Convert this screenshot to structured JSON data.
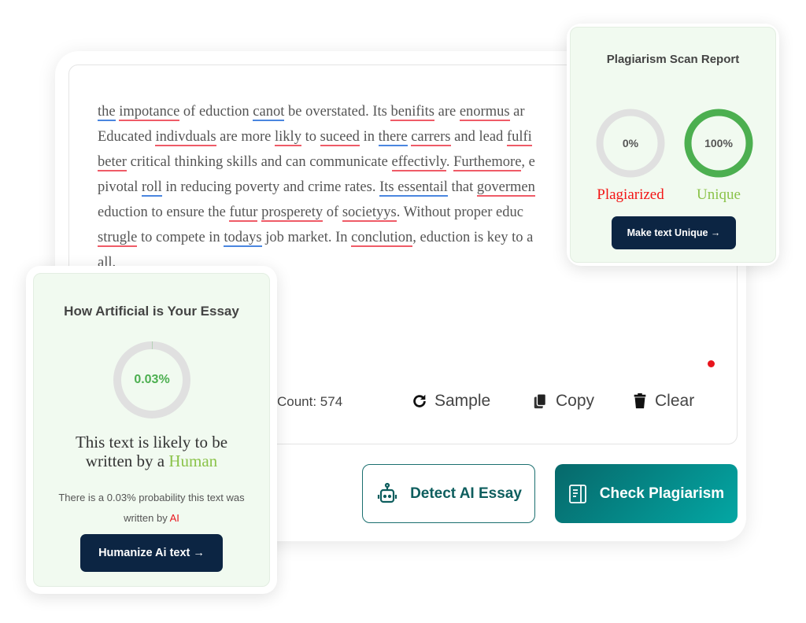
{
  "essay": {
    "lines": [
      [
        [
          "the",
          "b"
        ],
        " ",
        [
          "impotance",
          "r"
        ],
        " of eduction ",
        [
          "canot",
          "b"
        ],
        " be overstated. Its ",
        [
          "benifits",
          "r"
        ],
        " are ",
        [
          "enormus",
          "r"
        ],
        " ar"
      ],
      [
        "Educated ",
        [
          "indivduals",
          "r"
        ],
        " are more ",
        [
          "likly",
          "r"
        ],
        " to ",
        [
          "suceed",
          "r"
        ],
        " in ",
        [
          "there",
          "b"
        ],
        " ",
        [
          "carrers",
          "r"
        ],
        " and lead ",
        [
          "fulfi",
          "r"
        ]
      ],
      [
        [
          "beter",
          "r"
        ],
        " critical thinking skills and can communicate ",
        [
          "effectivly",
          "r"
        ],
        ". ",
        [
          "Furthemore",
          "r"
        ],
        ", e"
      ],
      [
        "pivotal ",
        [
          "roll",
          "b"
        ],
        " in reducing poverty and crime rates. ",
        [
          "Its essentail",
          "b"
        ],
        " that ",
        [
          "govermen",
          "r"
        ]
      ],
      [
        "eduction to ensure the ",
        [
          "futur",
          "r"
        ],
        " ",
        [
          "prosperety",
          "r"
        ],
        " of ",
        [
          "societyys",
          "r"
        ],
        ". Without proper educ"
      ],
      [
        [
          "strugle",
          "r"
        ],
        " to compete in ",
        [
          "todays",
          "b"
        ],
        " job market. In ",
        [
          "conclution",
          "r"
        ],
        ", eduction is key to a"
      ],
      [
        "all."
      ]
    ]
  },
  "toolbar": {
    "count": "Count: 574",
    "sample": "Sample",
    "copy": "Copy",
    "clear": "Clear"
  },
  "actions": {
    "detect": "Detect AI Essay",
    "check": "Check Plagiarism"
  },
  "report": {
    "title": "Plagiarism Scan Report",
    "plagiarized_pct": "0%",
    "plagiarized_value": 0,
    "unique_pct": "100%",
    "unique_value": 100,
    "plagiarized_label": "Plagiarized",
    "unique_label": "Unique",
    "button": "Make text Unique →"
  },
  "ai": {
    "title": "How Artificial is Your Essay",
    "pct": "0.03%",
    "value": 0.03,
    "verdict_1": "This text is likely to be",
    "verdict_2": "written by a",
    "verdict_word": "Human",
    "prob_1": "There is a 0.03% probability this text was",
    "prob_2": "written by",
    "prob_word": "AI",
    "button": "Humanize Ai text →"
  },
  "colors": {
    "red": "#ef5b67",
    "blue": "#4a86e0",
    "green": "#4caf50",
    "human": "#8bc34a",
    "navy": "#0c2543",
    "teal": "#06686a"
  }
}
